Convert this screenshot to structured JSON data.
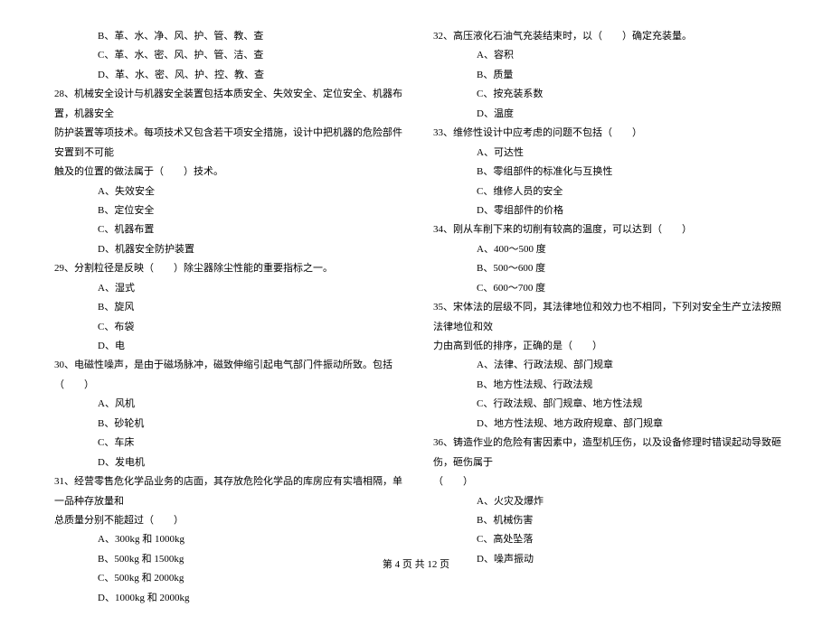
{
  "left": {
    "q27": {
      "b": "B、革、水、净、风、护、管、教、查",
      "c": "C、革、水、密、风、护、管、洁、查",
      "d": "D、革、水、密、风、护、控、教、查"
    },
    "q28": {
      "text1": "28、机械安全设计与机器安全装置包括本质安全、失效安全、定位安全、机器布置，机器安全",
      "text2": "防护装置等项技术。每项技术又包含若干项安全措施，设计中把机器的危险部件安置到不可能",
      "text3": "触及的位置的做法属于（　　）技术。",
      "a": "A、失效安全",
      "b": "B、定位安全",
      "c": "C、机器布置",
      "d": "D、机器安全防护装置"
    },
    "q29": {
      "text": "29、分割粒径是反映（　　）除尘器除尘性能的重要指标之一。",
      "a": "A、湿式",
      "b": "B、旋风",
      "c": "C、布袋",
      "d": "D、电"
    },
    "q30": {
      "text": "30、电磁性噪声，是由于磁场脉冲，磁致伸缩引起电气部门件振动所致。包括（　　）",
      "a": "A、风机",
      "b": "B、砂轮机",
      "c": "C、车床",
      "d": "D、发电机"
    },
    "q31": {
      "text1": "31、经营零售危化学品业务的店面，其存放危险化学品的库房应有实墙相隔，单一品种存放量和",
      "text2": "总质量分别不能超过（　　）",
      "a": "A、300kg 和 1000kg",
      "b": "B、500kg 和 1500kg",
      "c": "C、500kg 和 2000kg",
      "d": "D、1000kg 和 2000kg"
    }
  },
  "right": {
    "q32": {
      "text": "32、高压液化石油气充装结束时，以（　　）确定充装量。",
      "a": "A、容积",
      "b": "B、质量",
      "c": "C、按充装系数",
      "d": "D、温度"
    },
    "q33": {
      "text": "33、维修性设计中应考虑的问题不包括（　　）",
      "a": "A、可达性",
      "b": "B、零组部件的标准化与互换性",
      "c": "C、维修人员的安全",
      "d": "D、零组部件的价格"
    },
    "q34": {
      "text": "34、刚从车削下来的切削有较高的温度，可以达到（　　）",
      "a": "A、400～500 度",
      "b": "B、500～600 度",
      "c": "C、600～700 度"
    },
    "q35": {
      "text1": "35、宋体法的层级不同，其法律地位和效力也不相同，下列对安全生产立法按照法律地位和效",
      "text2": "力由高到低的排序，正确的是（　　）",
      "a": "A、法律、行政法规、部门规章",
      "b": "B、地方性法规、行政法规",
      "c": "C、行政法规、部门规章、地方性法规",
      "d": "D、地方性法规、地方政府规章、部门规章"
    },
    "q36": {
      "text1": "36、铸造作业的危险有害因素中，造型机压伤，以及设备修理时错误起动导致砸伤，砸伤属于",
      "text2": "（　　）",
      "a": "A、火灾及爆炸",
      "b": "B、机械伤害",
      "c": "C、高处坠落",
      "d": "D、噪声振动"
    }
  },
  "footer": "第 4 页 共 12 页"
}
